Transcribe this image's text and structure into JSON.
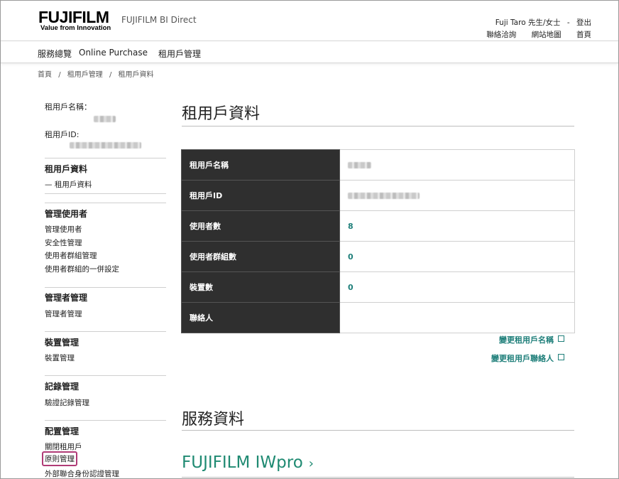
{
  "header": {
    "logo": "FUJIFILM",
    "logo_tagline": "Value from Innovation",
    "site_name": "FUJIFILM BI Direct",
    "user": "Fuji Taro 先生/女士",
    "separator": "-",
    "logout": "登出",
    "links": [
      "聯絡洽詢",
      "網站地圖",
      "首頁"
    ]
  },
  "topnav": [
    "服務總覽",
    "Online Purchase",
    "租用戶管理"
  ],
  "breadcrumb": [
    "首頁",
    "/",
    "租用戶管理",
    "/",
    "租用戶資料"
  ],
  "sidebar": {
    "tenant_name_label": "租用戶名稱：",
    "tenant_id_label": "租用戶ID:",
    "sections": [
      {
        "title": "租用戶資料",
        "items": [
          "— 租用戶資料"
        ]
      },
      {
        "title": "管理使用者",
        "items": [
          "管理使用者",
          "安全性管理",
          "使用者群組管理",
          "使用者群組的一併設定"
        ]
      },
      {
        "title": "管理者管理",
        "items": [
          "管理者管理"
        ]
      },
      {
        "title": "裝置管理",
        "items": [
          "裝置管理"
        ]
      },
      {
        "title": "記錄管理",
        "items": [
          "驗證記錄管理"
        ]
      },
      {
        "title": "配置管理",
        "items": [
          "關閉租用戶",
          "原則管理",
          "外部聯合身份認證管理"
        ]
      }
    ]
  },
  "main": {
    "title": "租用戶資料",
    "table": [
      {
        "label": "租用戶名稱",
        "value": ""
      },
      {
        "label": "租用戶ID",
        "value": ""
      },
      {
        "label": "使用者數",
        "value": "8"
      },
      {
        "label": "使用者群組數",
        "value": "0"
      },
      {
        "label": "裝置數",
        "value": "0"
      },
      {
        "label": "聯絡人",
        "value": ""
      }
    ],
    "change_name_link": "變更租用戶名稱",
    "change_contact_link": "變更租用戶聯絡人",
    "service_title": "服務資料",
    "product": "FUJIFILM IWpro",
    "product_chevron": "›"
  },
  "colors": {
    "accent": "#1f7f7a",
    "highlight": "#b03b76",
    "table_header": "#2f2f2f"
  }
}
